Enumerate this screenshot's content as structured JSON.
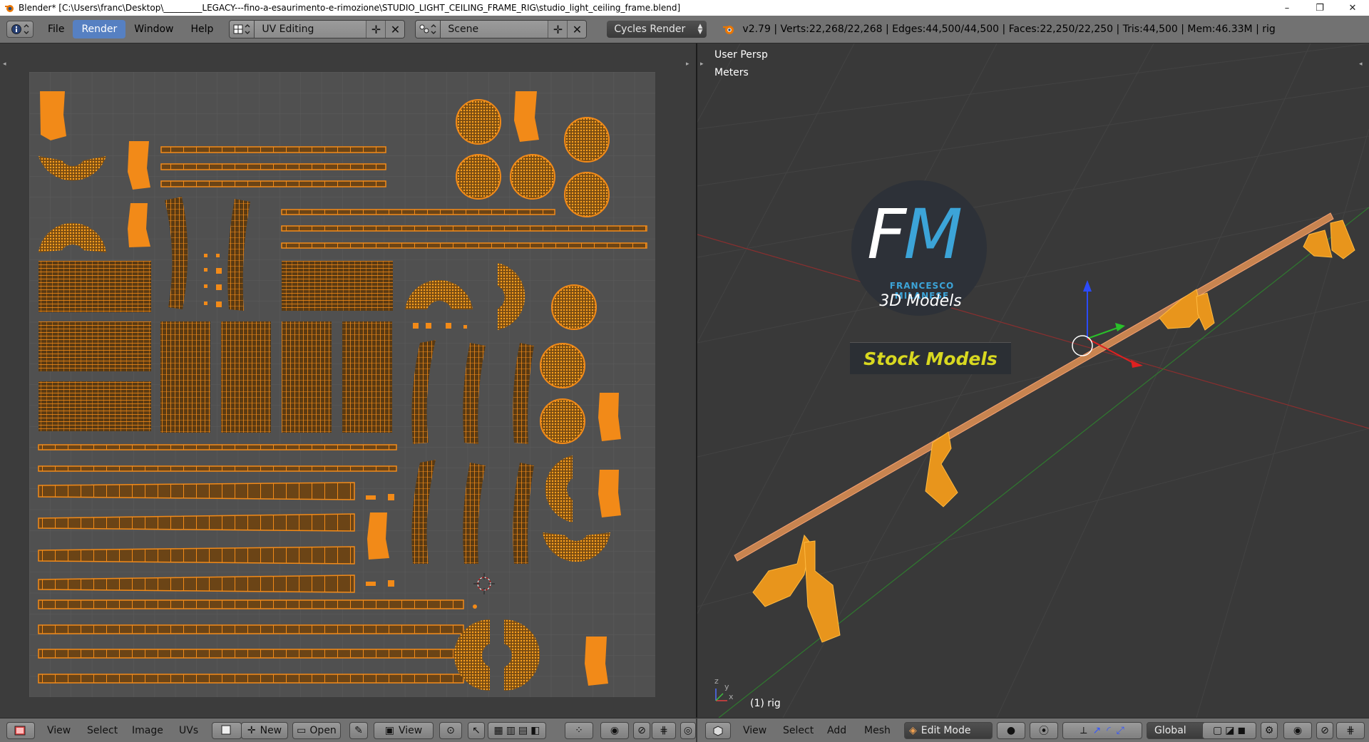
{
  "window": {
    "title": "Blender* [C:\\Users\\franc\\Desktop\\_________LEGACY---fino-a-esaurimento-e-rimozione\\STUDIO_LIGHT_CEILING_FRAME_RIG\\studio_light_ceiling_frame.blend]",
    "minimize": "–",
    "maximize": "❐",
    "close": "✕"
  },
  "info_header": {
    "menus": [
      "File",
      "Render",
      "Window",
      "Help"
    ],
    "active_menu": "Render",
    "screen_layout": "UV Editing",
    "scene": "Scene",
    "render_engine": "Cycles Render",
    "stats": "v2.79 | Verts:22,268/22,268 | Edges:44,500/44,500 | Faces:22,250/22,250 | Tris:44,500 | Mem:46.33M | rig"
  },
  "viewport": {
    "view_name": "User Persp",
    "units": "Meters",
    "object_label": "(1) rig",
    "axis_x": "x",
    "axis_y": "y",
    "axis_z": "z"
  },
  "watermark": {
    "letter_f": "F",
    "letter_m": "M",
    "name": "FRANCESCO MILANESE",
    "subtitle": "3D Models",
    "tag": "Stock Models"
  },
  "uv_header": {
    "menus": [
      "View",
      "Select",
      "Image",
      "UVs"
    ],
    "new_label": "New",
    "open_label": "Open",
    "view_label": "View"
  },
  "view3d_header": {
    "menus": [
      "View",
      "Select",
      "Add",
      "Mesh"
    ],
    "mode": "Edit Mode",
    "orientation": "Global"
  },
  "colors": {
    "uv_orange": "#f28a18",
    "header_gray": "#727272",
    "active_blue": "#5680c2",
    "brand_blue": "#3ca4d8",
    "stock_yellow": "#d8d820"
  }
}
